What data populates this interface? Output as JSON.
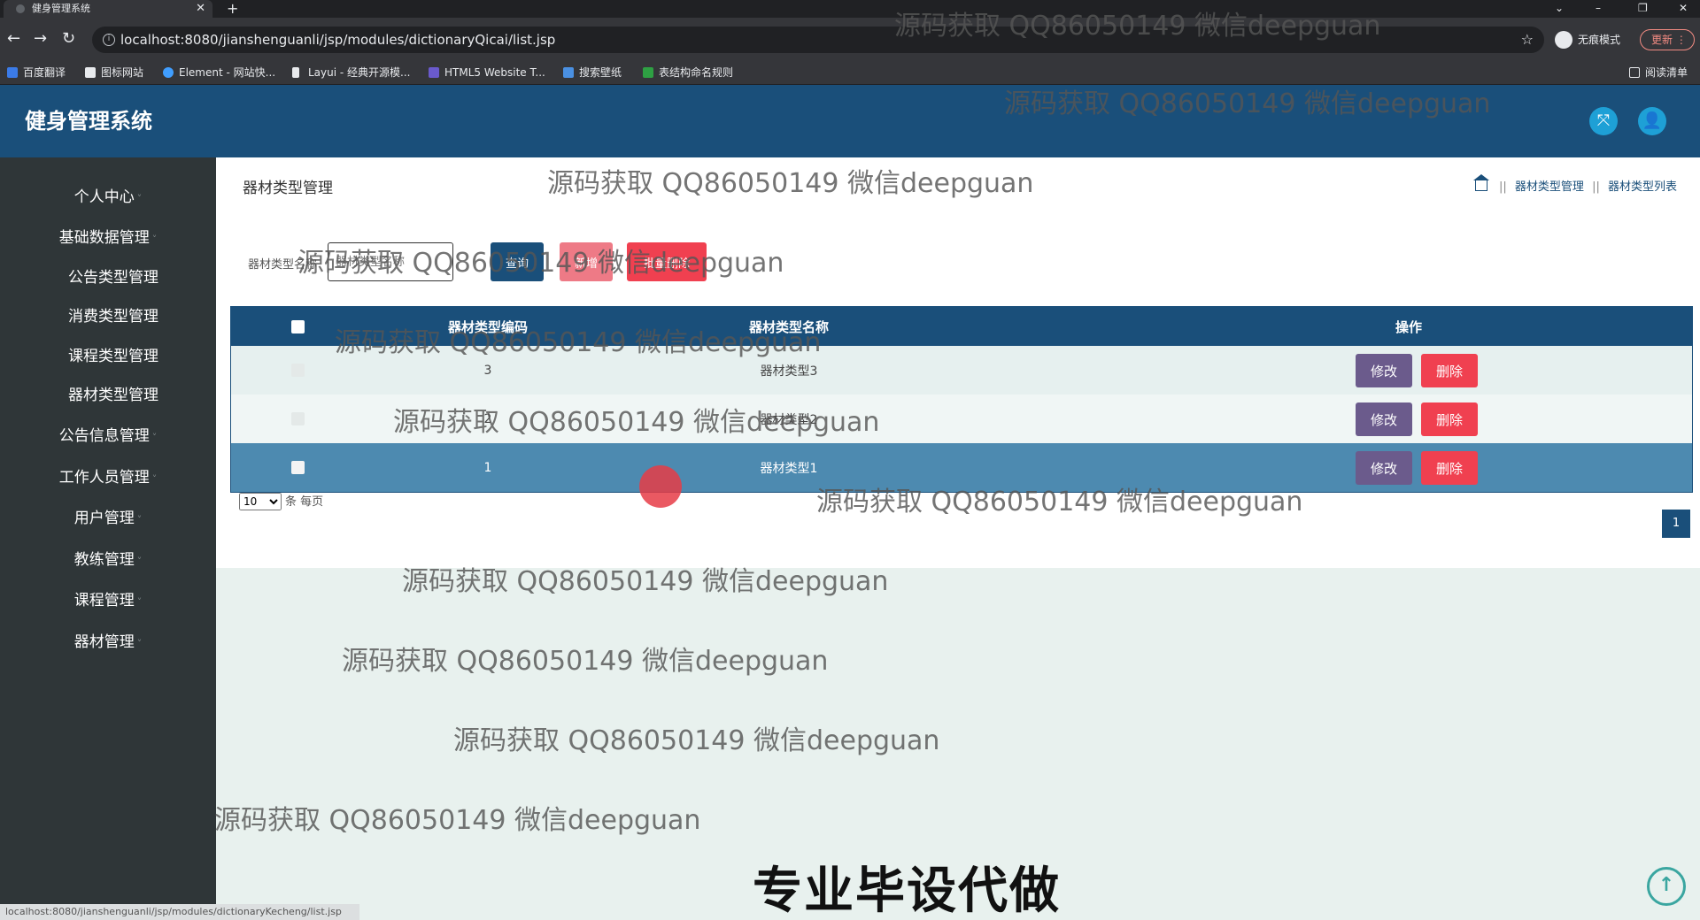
{
  "browser": {
    "tab_title": "健身管理系统",
    "tab_close": "✕",
    "new_tab": "+",
    "url": "localhost:8080/jianshenguanli/jsp/modules/dictionaryQicai/list.jsp",
    "incognito_label": "无痕模式",
    "update_label": "更新",
    "bookmarks": [
      "百度翻译",
      "图标网站",
      "Element - 网站快...",
      "Layui - 经典开源模...",
      "HTML5 Website T...",
      "搜索壁纸",
      "表结构命名规则"
    ],
    "reading_list": "阅读清单",
    "status_url": "localhost:8080/jianshenguanli/jsp/modules/dictionaryKecheng/list.jsp"
  },
  "app": {
    "title": "健身管理系统"
  },
  "sidebar": {
    "items": [
      "个人中心",
      "基础数据管理",
      "公告类型管理",
      "消费类型管理",
      "课程类型管理",
      "器材类型管理",
      "公告信息管理",
      "工作人员管理",
      "用户管理",
      "教练管理",
      "课程管理",
      "器材管理"
    ]
  },
  "page": {
    "title": "器材类型管理",
    "breadcrumb": [
      "器材类型管理",
      "器材类型列表"
    ],
    "breadcrumb_sep": "||"
  },
  "search": {
    "label": "器材类型名称",
    "placeholder": "器材类型名称",
    "query_label": "查询",
    "add_label": "新增",
    "batch_delete_label": "批量删除"
  },
  "table": {
    "headers": [
      "器材类型编码",
      "器材类型名称",
      "操作"
    ],
    "rows": [
      {
        "code": "3",
        "name": "器材类型3"
      },
      {
        "code": "2",
        "name": "器材类型2"
      },
      {
        "code": "1",
        "name": "器材类型1"
      }
    ],
    "edit_label": "修改",
    "delete_label": "删除"
  },
  "pagination": {
    "page_size": "10",
    "per_page_suffix": "条 每页",
    "current_page": "1"
  },
  "watermark": "源码获取 QQ86050149 微信deepguan",
  "caption": "专业毕设代做",
  "icons": {
    "fullscreen": "fullscreen-icon",
    "user": "user-icon",
    "home": "home-icon",
    "back_to_top": "arrow-up-icon"
  },
  "colors": {
    "header": "#1a4f7a",
    "sidebar": "#2f3638",
    "edit": "#6b5b8c",
    "delete": "#f04050",
    "add": "#ee7a86"
  }
}
